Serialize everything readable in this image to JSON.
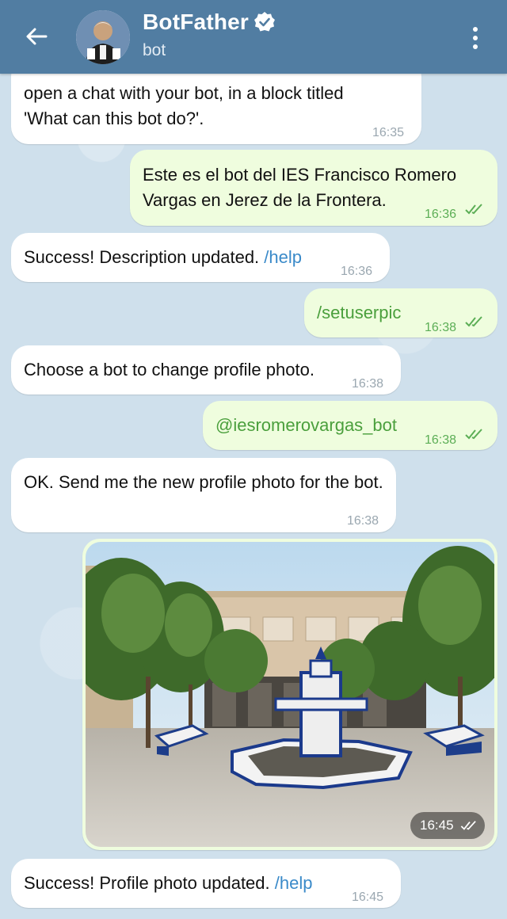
{
  "header": {
    "title": "BotFather",
    "subtitle": "bot"
  },
  "messages": [
    {
      "dir": "in",
      "lines": [
        "open a chat with your bot, in a block titled",
        "'What can this bot do?'."
      ],
      "time": "16:35"
    },
    {
      "dir": "out",
      "text": "Este es el bot del IES Francisco Romero Vargas en Jerez de la Frontera.",
      "time": "16:36",
      "status": "read"
    },
    {
      "dir": "in",
      "text": "Success! Description updated.",
      "link": "/help",
      "time": "16:36"
    },
    {
      "dir": "out",
      "text": "/setuserpic",
      "time": "16:38",
      "status": "read"
    },
    {
      "dir": "in",
      "text": "Choose a bot to change profile photo.",
      "time": "16:38"
    },
    {
      "dir": "out",
      "text": "@iesromerovargas_bot",
      "time": "16:38",
      "status": "read"
    },
    {
      "dir": "in",
      "text": "OK. Send me the new profile photo for the bot.",
      "time": "16:38"
    },
    {
      "dir": "out",
      "type": "photo",
      "time": "16:45",
      "status": "read"
    },
    {
      "dir": "in",
      "text": "Success! Profile photo updated.",
      "link": "/help",
      "time": "16:45"
    }
  ],
  "colors": {
    "header": "#517da2",
    "incoming": "#ffffff",
    "outgoing": "#effdde",
    "link": "#3a8ac9",
    "read_check": "#5cae56"
  },
  "icons": [
    "back-arrow-icon",
    "verified-badge-icon",
    "more-vert-icon",
    "double-check-icon"
  ]
}
